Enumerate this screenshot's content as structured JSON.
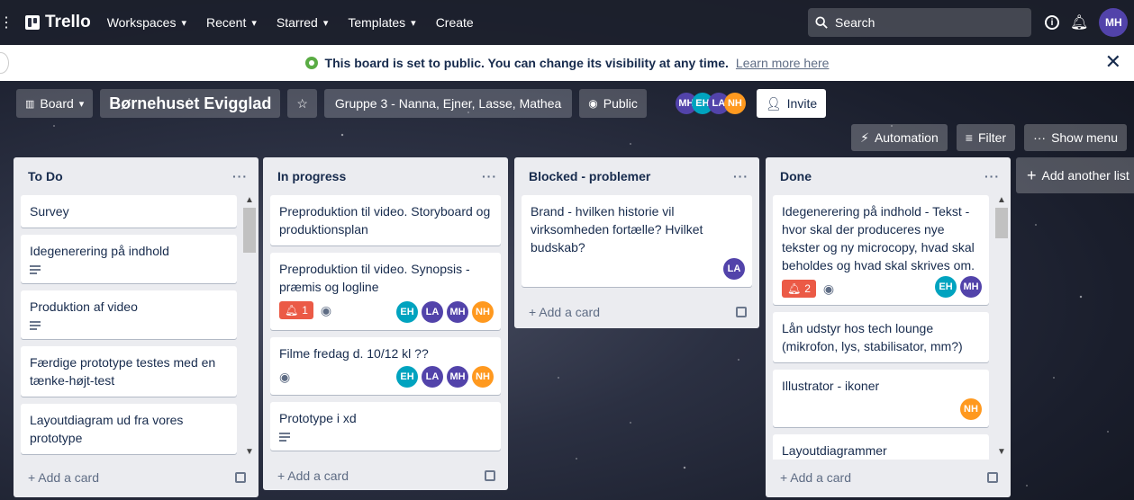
{
  "nav": {
    "logo": "Trello",
    "items": [
      {
        "label": "Workspaces",
        "chevron": true
      },
      {
        "label": "Recent",
        "chevron": true
      },
      {
        "label": "Starred",
        "chevron": true
      },
      {
        "label": "Templates",
        "chevron": true
      },
      {
        "label": "Create",
        "chevron": false
      }
    ],
    "search_placeholder": "Search",
    "user_initials": "MH"
  },
  "banner": {
    "text": "This board is set to public. You can change its visibility at any time.",
    "link": "Learn more here"
  },
  "board": {
    "view_label": "Board",
    "title": "Børnehuset Evigglad",
    "workspace": "Gruppe 3 - Nanna, Ejner, Lasse, Mathea",
    "visibility": "Public",
    "members": [
      "MH",
      "EH",
      "LA",
      "NH"
    ],
    "invite": "Invite",
    "automation": "Automation",
    "filter": "Filter",
    "show_menu": "Show menu",
    "add_list": "Add another list"
  },
  "lists": [
    {
      "title": "To Do",
      "add_card": "Add a card",
      "cards": [
        {
          "title": "Survey"
        },
        {
          "title": "Idegenerering på indhold",
          "desc": true
        },
        {
          "title": "Produktion af video",
          "desc": true
        },
        {
          "title": "Færdige prototype testes med en tænke-højt-test"
        },
        {
          "title": "Layoutdiagram ud fra vores prototype"
        }
      ]
    },
    {
      "title": "In progress",
      "add_card": "Add a card",
      "cards": [
        {
          "title": "Preproduktion til video. Storyboard og produktionsplan"
        },
        {
          "title": "Preproduktion til video. Synopsis - præmis og logline",
          "bell_count": "1",
          "watch": true,
          "members": [
            "EH",
            "LA",
            "MH",
            "NH"
          ]
        },
        {
          "title": "Filme fredag d. 10/12 kl ??",
          "watch": true,
          "members": [
            "EH",
            "LA",
            "MH",
            "NH"
          ]
        },
        {
          "title": "Prototype i xd",
          "desc": true
        }
      ]
    },
    {
      "title": "Blocked - problemer",
      "add_card": "Add a card",
      "cards": [
        {
          "title": "Brand - hvilken historie vil virksomheden fortælle? Hvilket budskab?",
          "members": [
            "LA"
          ]
        }
      ]
    },
    {
      "title": "Done",
      "add_card": "Add a card",
      "cards": [
        {
          "title": "Idegenerering på indhold - Tekst - hvor skal der produceres nye tekster og ny microcopy, hvad skal beholdes og hvad skal skrives om.",
          "bell_count": "2",
          "watch": true,
          "members": [
            "EH",
            "MH"
          ]
        },
        {
          "title": "Lån udstyr hos tech lounge (mikrofon, lys, stabilisator, mm?)"
        },
        {
          "title": "Illustrator - ikoner",
          "members": [
            "NH"
          ]
        },
        {
          "title": "Layoutdiagrammer"
        }
      ]
    }
  ],
  "member_colors": {
    "MH": "#5243aa",
    "EH": "#00a3bf",
    "LA": "#5243aa",
    "NH": "#ff991f"
  }
}
